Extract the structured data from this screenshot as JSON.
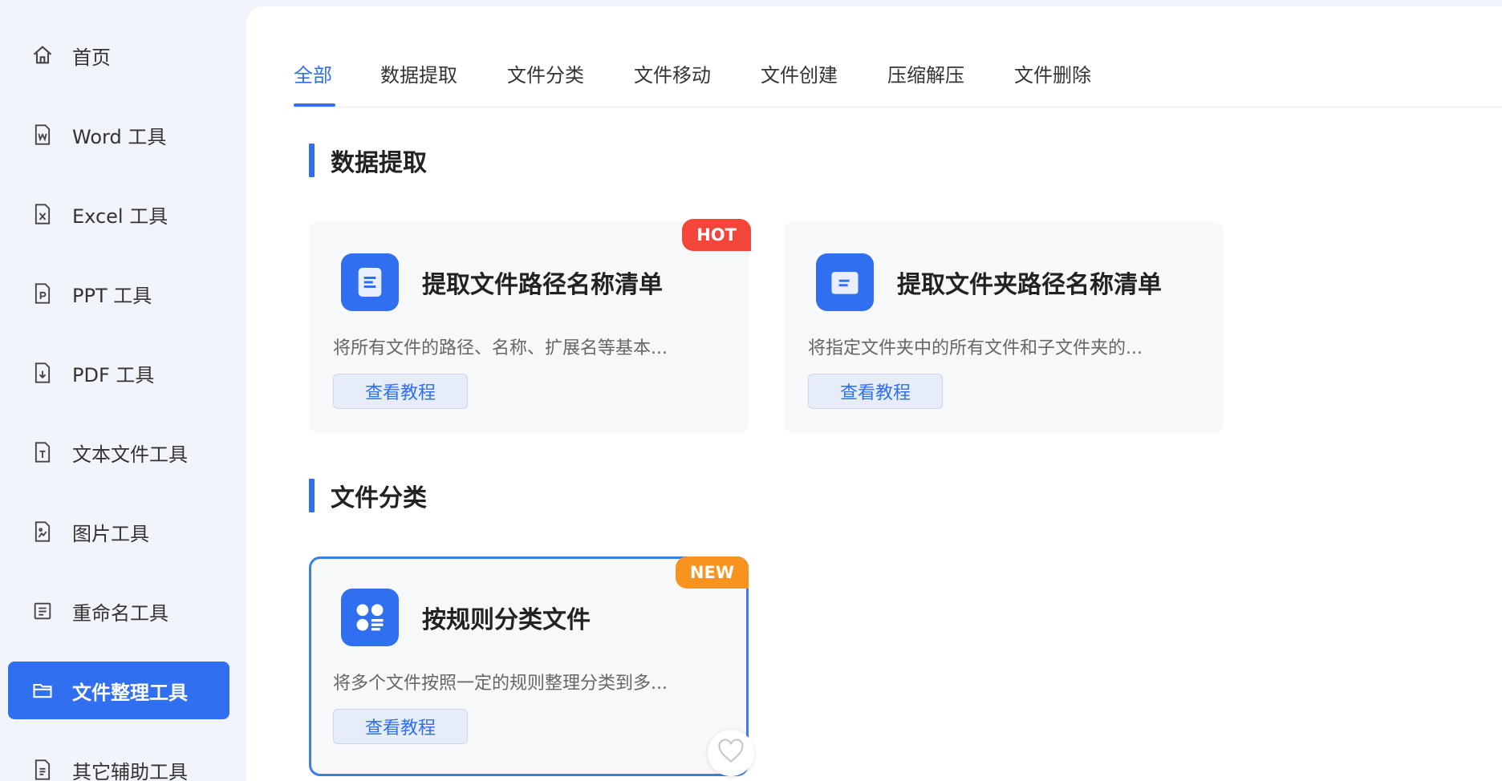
{
  "sidebar": {
    "items": [
      {
        "label": "首页",
        "icon": "home-icon"
      },
      {
        "label": "Word 工具",
        "icon": "word-file-icon"
      },
      {
        "label": "Excel 工具",
        "icon": "excel-file-icon"
      },
      {
        "label": "PPT 工具",
        "icon": "ppt-file-icon"
      },
      {
        "label": "PDF 工具",
        "icon": "pdf-file-icon"
      },
      {
        "label": "文本文件工具",
        "icon": "text-file-icon"
      },
      {
        "label": "图片工具",
        "icon": "image-file-icon"
      },
      {
        "label": "重命名工具",
        "icon": "rename-icon"
      },
      {
        "label": "文件整理工具",
        "icon": "folder-icon",
        "active": true
      },
      {
        "label": "其它辅助工具",
        "icon": "tools-icon"
      }
    ]
  },
  "tabs": [
    {
      "label": "全部",
      "active": true
    },
    {
      "label": "数据提取"
    },
    {
      "label": "文件分类"
    },
    {
      "label": "文件移动"
    },
    {
      "label": "文件创建"
    },
    {
      "label": "压缩解压"
    },
    {
      "label": "文件删除"
    }
  ],
  "sections": [
    {
      "title": "数据提取",
      "cards": [
        {
          "title": "提取文件路径名称清单",
          "desc": "将所有文件的路径、名称、扩展名等基本...",
          "button": "查看教程",
          "badge": "HOT"
        },
        {
          "title": "提取文件夹路径名称清单",
          "desc": "将指定文件夹中的所有文件和子文件夹的...",
          "button": "查看教程"
        }
      ]
    },
    {
      "title": "文件分类",
      "cards": [
        {
          "title": "按规则分类文件",
          "desc": "将多个文件按照一定的规则整理分类到多...",
          "button": "查看教程",
          "badge": "NEW"
        }
      ]
    }
  ],
  "colors": {
    "accent": "#2f6ff0",
    "hot": "#f2463b",
    "new": "#f7931e",
    "sidebar_bg": "#f1f4fa"
  }
}
